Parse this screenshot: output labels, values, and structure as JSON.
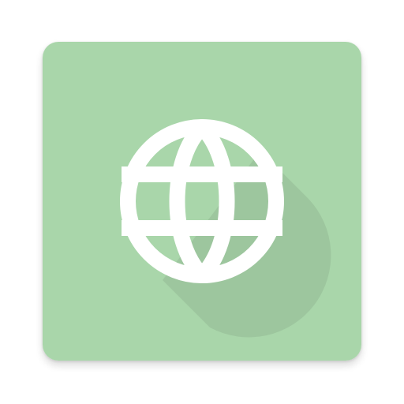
{
  "icon": {
    "name": "globe-icon",
    "tile_color": "#a9d6aa",
    "glyph_color": "#ffffff",
    "long_shadow_color": "#000000"
  }
}
